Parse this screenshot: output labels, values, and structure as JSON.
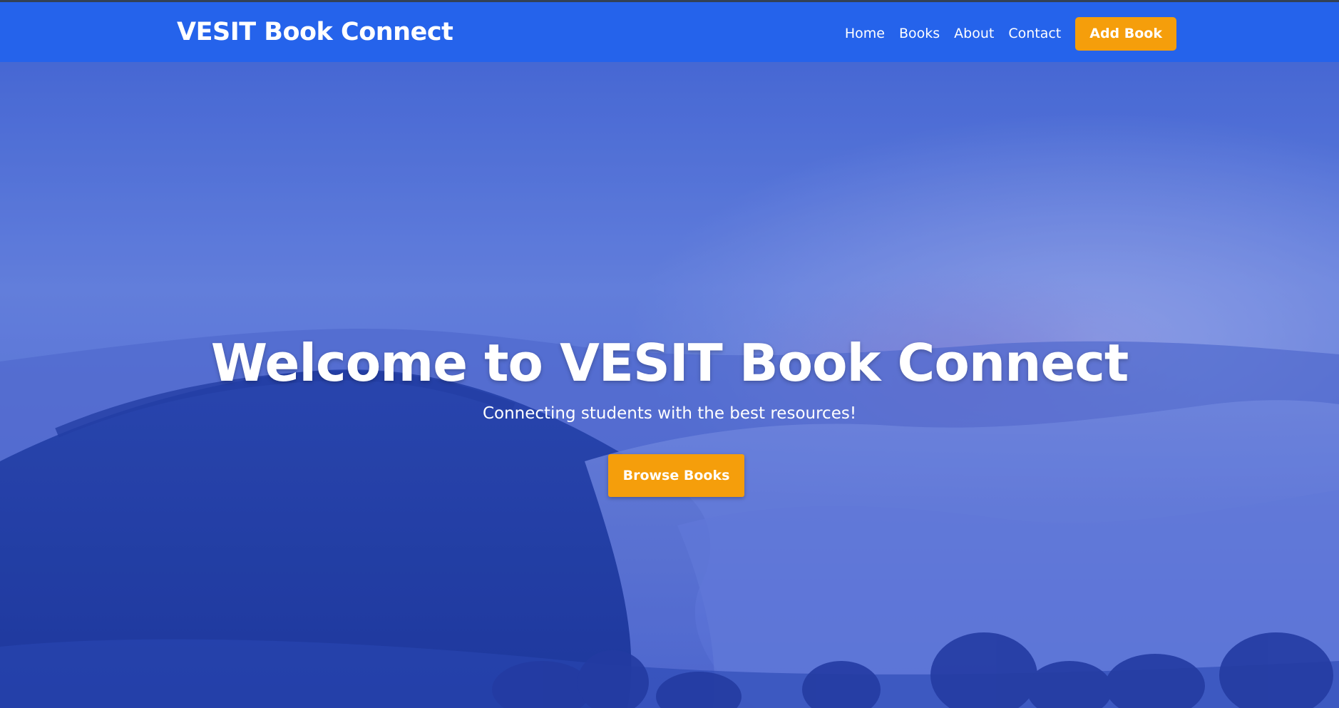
{
  "navbar": {
    "brand": "VESIT Book Connect",
    "links": [
      {
        "label": "Home"
      },
      {
        "label": "Books"
      },
      {
        "label": "About"
      },
      {
        "label": "Contact"
      }
    ],
    "cta_label": "Add Book"
  },
  "hero": {
    "title": "Welcome to VESIT Book Connect",
    "subtitle": "Connecting students with the best resources!",
    "button_label": "Browse Books",
    "background_icon": "misty-mountain-landscape"
  },
  "colors": {
    "navbar_bg": "#2563eb",
    "accent": "#f59e0b",
    "text": "#ffffff"
  }
}
